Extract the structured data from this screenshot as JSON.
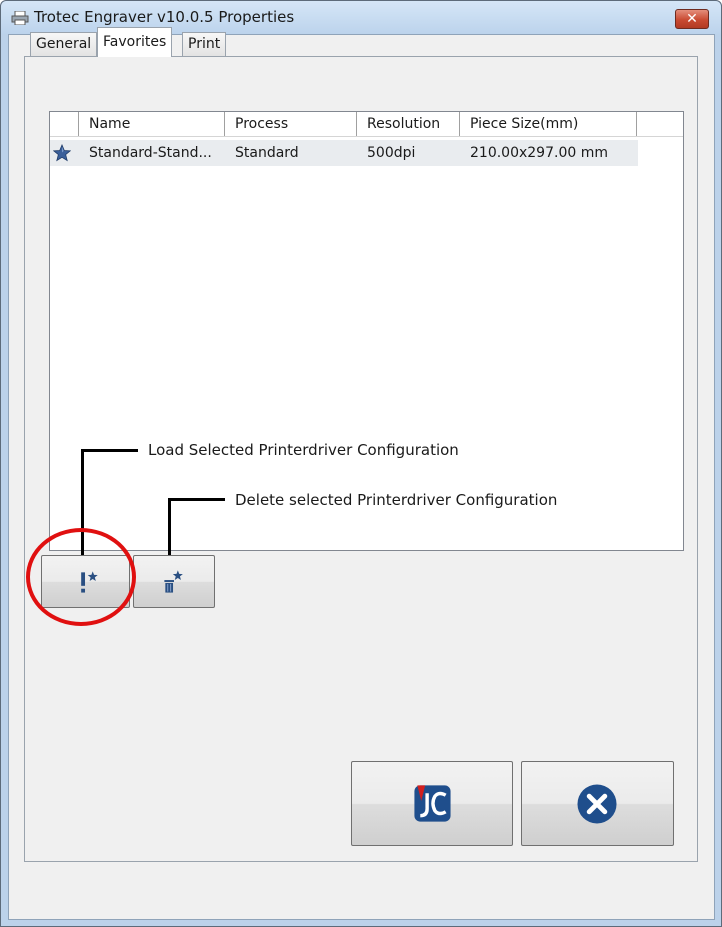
{
  "window": {
    "title": "Trotec Engraver v10.0.5 Properties",
    "close_symbol": "✕",
    "icon": "printer-icon"
  },
  "tabs": [
    {
      "label": "General",
      "active": false
    },
    {
      "label": "Favorites",
      "active": true
    },
    {
      "label": "Print",
      "active": false
    }
  ],
  "favorites_list": {
    "columns": [
      "Name",
      "Process",
      "Resolution",
      "Piece Size(mm)"
    ],
    "rows": [
      {
        "icon": "star-icon",
        "name": "Standard-Stand...",
        "process": "Standard",
        "resolution": "500dpi",
        "piece_size": "210.00x297.00 mm",
        "selected": true
      }
    ]
  },
  "buttons": {
    "load": {
      "icon": "load-favorite-icon"
    },
    "delete": {
      "icon": "delete-favorite-icon"
    },
    "jobcontrol": {
      "icon": "jobcontrol-icon"
    },
    "cancel": {
      "icon": "cancel-icon"
    }
  },
  "annotations": {
    "load_label": "Load Selected Printerdriver Configuration",
    "delete_label": "Delete selected Printerdriver Configuration",
    "highlight_color": "#e01010"
  },
  "colors": {
    "title_bar": "#bcd3ec",
    "close_button": "#c94a32",
    "jobcontrol_blue": "#1f4e8c",
    "cancel_blue": "#1f4e8c",
    "star_blue": "#3a5f9a"
  }
}
